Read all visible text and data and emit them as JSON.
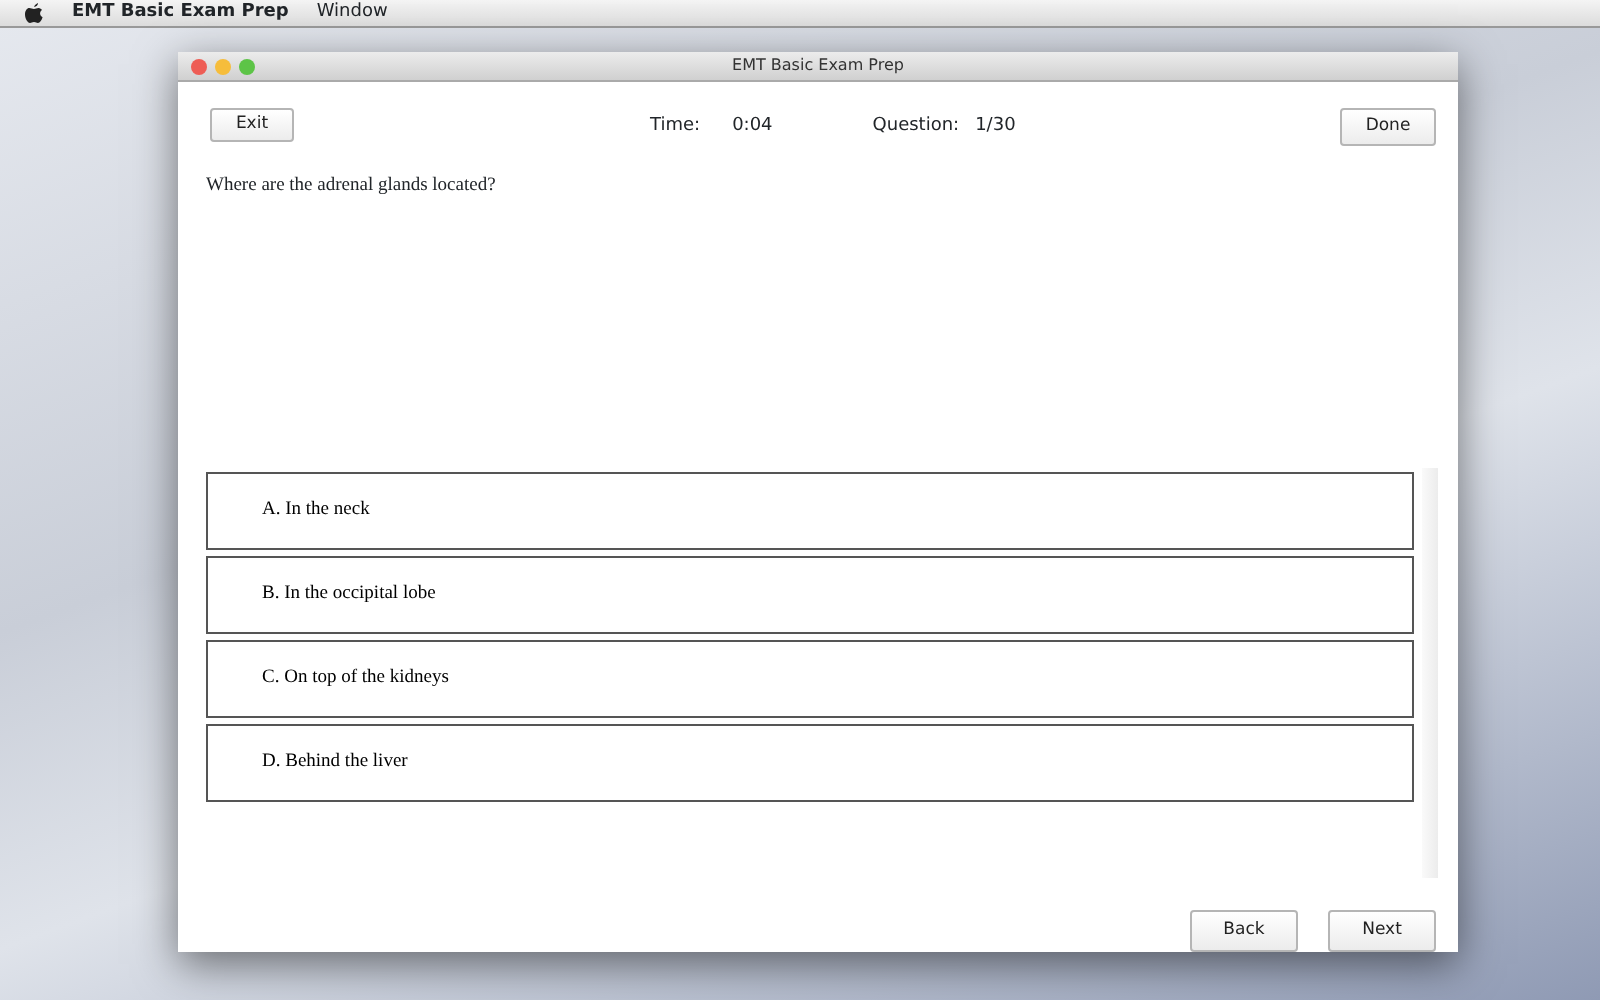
{
  "menu_bar": {
    "app_name": "EMT Basic Exam Prep",
    "items": [
      "Window"
    ]
  },
  "window": {
    "title": "EMT Basic Exam Prep"
  },
  "toolbar": {
    "exit_button": "Exit",
    "time_label": "Time:",
    "time_value": "0:04",
    "question_label": "Question:",
    "question_value": "1/30",
    "done_button": "Done"
  },
  "question": "Where are the adrenal glands located?",
  "answers": [
    {
      "text": "A. In the neck",
      "selected": false
    },
    {
      "text": "B. In the occipital lobe",
      "selected": false
    },
    {
      "text": "C. On top of the kidneys",
      "selected": false
    },
    {
      "text": "D. Behind the liver",
      "selected": false
    }
  ],
  "buttons": [
    "Back",
    "Next"
  ]
}
